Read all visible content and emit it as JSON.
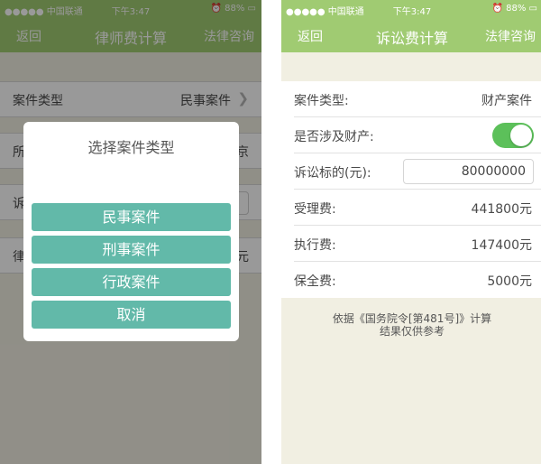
{
  "status_bar": {
    "carrier": "●●●●● 中国联通 ",
    "time": "下午3:47",
    "battery": "⏰ 88% ▭"
  },
  "left_screen": {
    "nav": {
      "back": "返回",
      "title": "律师费计算",
      "right": "法律咨询"
    },
    "rows": {
      "case_type_label": "案件类型",
      "case_type_value": "民事案件",
      "row2_label": "所",
      "row2_value": "京",
      "row3_label": "诉",
      "row4_label": "律",
      "row4_value": "元"
    },
    "dialog": {
      "title": "选择案件类型",
      "options": [
        "民事案件",
        "刑事案件",
        "行政案件",
        "取消"
      ]
    }
  },
  "right_screen": {
    "nav": {
      "back": "返回",
      "title": "诉讼费计算",
      "right": "法律咨询"
    },
    "case_type_label": "案件类型:",
    "case_type_value": "财产案件",
    "property_label": "是否涉及财产:",
    "property_toggle_on": true,
    "amount_label": "诉讼标的(元):",
    "amount_value": "80000000",
    "acceptance_fee_label": "受理费:",
    "acceptance_fee_value": "441800元",
    "execution_fee_label": "执行费:",
    "execution_fee_value": "147400元",
    "preservation_fee_label": "保全费:",
    "preservation_fee_value": "5000元",
    "note_line1": "依据《国务院令[第481号]》计算",
    "note_line2": "结果仅供参考"
  },
  "colors": {
    "nav_green": "#a0cb72",
    "dialog_button_teal": "#62b9a9",
    "toggle_on_green": "#5cc05a",
    "background_beige": "#f1efe2"
  },
  "icons": {
    "chevron": "chevron-right-icon",
    "alarm": "alarm-icon",
    "battery": "battery-icon"
  }
}
